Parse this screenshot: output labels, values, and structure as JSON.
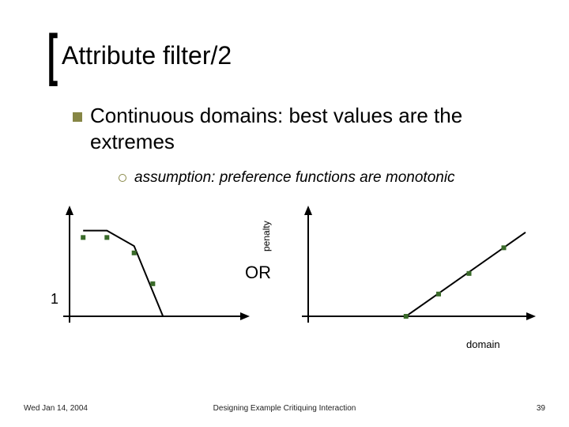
{
  "title": "Attribute filter/2",
  "bullet": "Continuous domains: best values are the extremes",
  "sub_bullet": "assumption: preference functions are monotonic",
  "chart_data": [
    {
      "type": "line",
      "title": "",
      "xlabel": "",
      "ylabel": "penalty",
      "yticks": [
        "1"
      ],
      "x": [
        0.08,
        0.22,
        0.38,
        0.55,
        1.0
      ],
      "y": [
        1.0,
        1.0,
        0.82,
        0.0,
        0.0
      ],
      "markers_x": [
        0.08,
        0.22,
        0.38,
        0.49
      ],
      "markers_y": [
        0.92,
        0.92,
        0.74,
        0.38
      ],
      "xlim": [
        0,
        1
      ],
      "ylim": [
        0,
        1.2
      ]
    },
    {
      "type": "line",
      "title": "",
      "xlabel": "domain",
      "ylabel": "",
      "x": [
        0.0,
        0.45,
        1.0
      ],
      "y": [
        0.0,
        0.0,
        0.98
      ],
      "markers_x": [
        0.45,
        0.6,
        0.74,
        0.9
      ],
      "markers_y": [
        0.0,
        0.26,
        0.5,
        0.8
      ],
      "xlim": [
        0,
        1
      ],
      "ylim": [
        0,
        1.2
      ]
    }
  ],
  "or_label": "OR",
  "footer": {
    "left": "Wed Jan 14, 2004",
    "mid": "Designing Example Critiquing Interaction",
    "right": "39"
  }
}
